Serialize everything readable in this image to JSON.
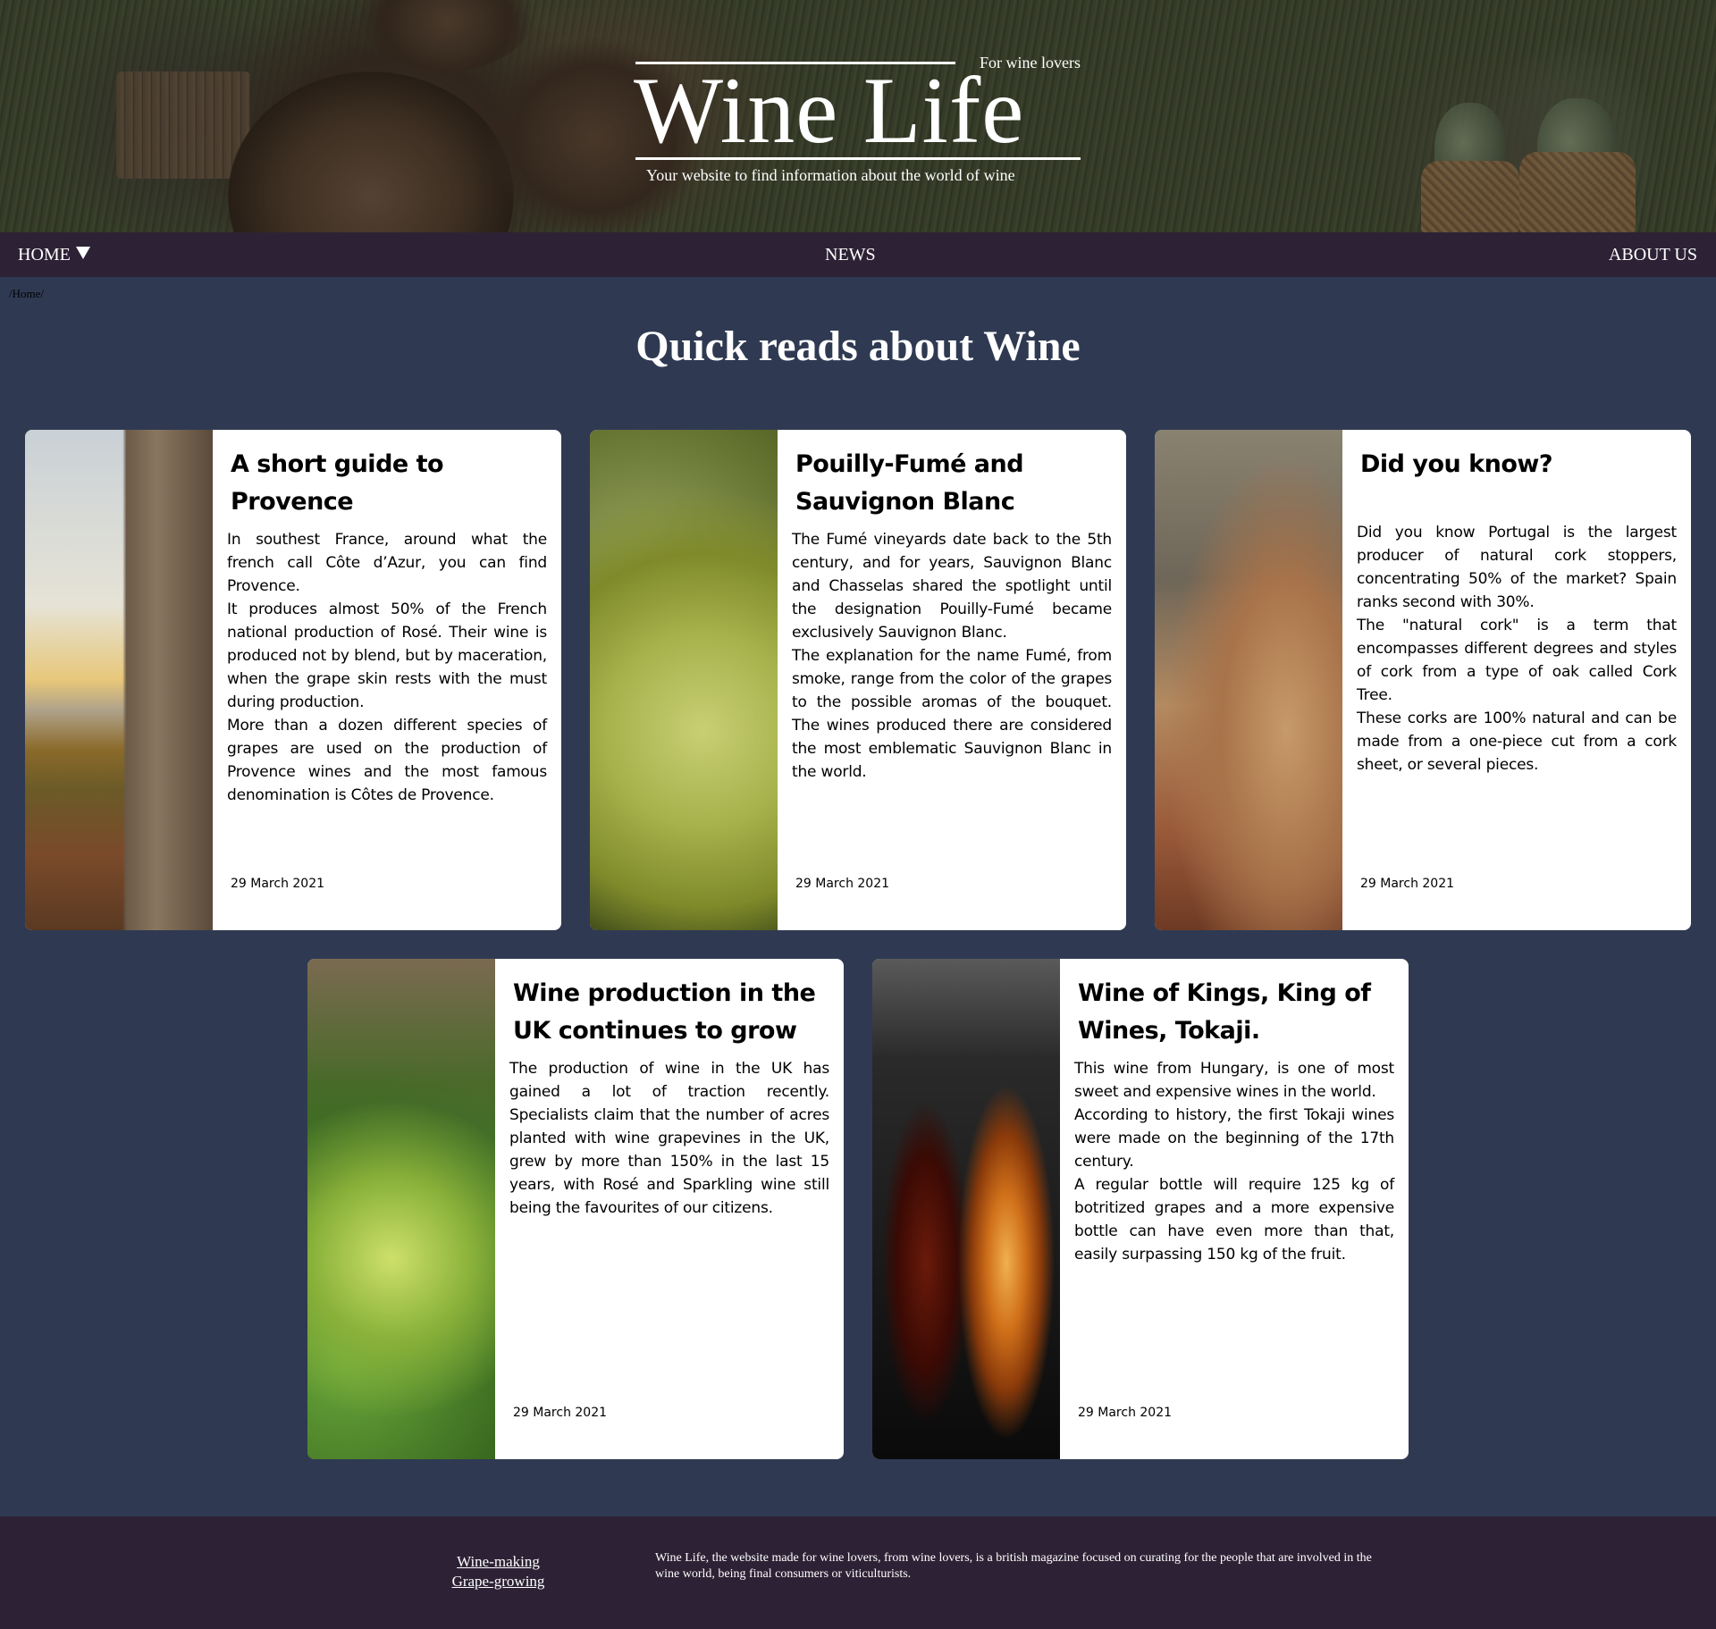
{
  "header": {
    "tagline": "For wine lovers",
    "title": "Wine Life",
    "subtitle": "Your website to find information about the world of wine"
  },
  "nav": {
    "home": "HOME",
    "news": "NEWS",
    "about": "ABOUT US"
  },
  "breadcrumb": "/Home/",
  "main": {
    "title": "Quick reads about Wine"
  },
  "cards": [
    {
      "title": "A short guide to Provence",
      "paragraphs": [
        "In southest France, around what the french call Côte d’Azur, you can find Provence.",
        "It produces almost 50% of the French national production of Rosé. Their wine is produced not by blend, but by maceration, when the grape skin rests with the must during production.",
        "More than a dozen different species of grapes are used on the production of Provence wines and the most famous denomination is Côtes de Provence."
      ],
      "date": "29 March 2021"
    },
    {
      "title": "Pouilly-Fumé and Sauvignon Blanc",
      "paragraphs": [
        "The Fumé vineyards date back to the 5th century, and for years, Sauvignon Blanc and Chasselas shared the spotlight until the designation Pouilly-Fumé became exclusively Sauvignon Blanc.",
        "The explanation for the name Fumé, from smoke, range from the color of the grapes to the possible aromas of the bouquet. The wines produced there are considered the most emblematic Sauvignon Blanc in the world."
      ],
      "date": "29 March 2021"
    },
    {
      "title": "Did you know?",
      "paragraphs": [
        "Did you know Portugal is the largest producer of natural cork stoppers, concentrating 50% of the market? Spain ranks second with 30%.",
        "The \"natural cork\" is a term that encompasses different degrees and styles of cork from a type of oak called Cork Tree.",
        "These corks are 100% natural and can be made from a one-piece cut from a cork sheet, or several pieces."
      ],
      "date": "29 March 2021"
    },
    {
      "title": "Wine production in the UK continues to grow",
      "paragraphs": [
        "The production of wine in the UK has gained a lot of traction recently. Specialists claim that the number of acres planted with wine grapevines in the UK, grew by more than 150% in the last 15 years, with Rosé and Sparkling wine still being the favourites of our citizens."
      ],
      "date": "29 March 2021"
    },
    {
      "title": "Wine of Kings, King of Wines, Tokaji.",
      "paragraphs": [
        "This wine from Hungary, is one of most sweet and expensive wines in the world.",
        "According to history, the first Tokaji wines were made on the beginning of the 17th century.",
        "A regular bottle will require 125 kg of botritized grapes and a more expensive bottle can have even more than that, easily surpassing 150 kg of the fruit."
      ],
      "date": "29 March 2021"
    }
  ],
  "footer": {
    "links": [
      "Wine-making",
      "Grape-growing"
    ],
    "about": "Wine Life, the website made for wine lovers, from wine lovers, is a british magazine focused on curating for the people that are involved in the wine world, being final consumers or viticulturists."
  },
  "colors": {
    "page_background": "#2f3a52",
    "nav_background": "#2d2235",
    "footer_background": "#2d2235",
    "card_background": "#ffffff",
    "text_light": "#ffffff"
  },
  "icons": {
    "home_dropdown": "caret-down-icon"
  }
}
